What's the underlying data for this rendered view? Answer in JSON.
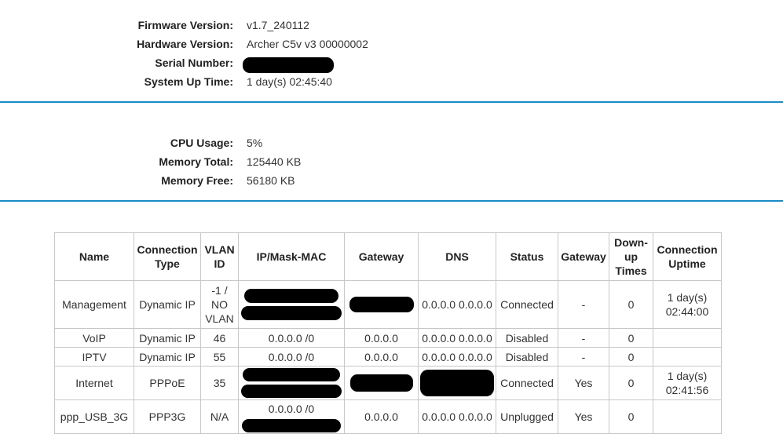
{
  "device_info": {
    "firmware": {
      "label": "Firmware Version:",
      "value": "v1.7_240112"
    },
    "hardware": {
      "label": "Hardware Version:",
      "value": "Archer C5v v3 00000002"
    },
    "serial": {
      "label": "Serial Number:",
      "value": ""
    },
    "uptime": {
      "label": "System Up Time:",
      "value": "1 day(s) 02:45:40"
    }
  },
  "resources": {
    "cpu": {
      "label": "CPU Usage:",
      "value": "5%"
    },
    "mem_total": {
      "label": "Memory Total:",
      "value": "125440 KB"
    },
    "mem_free": {
      "label": "Memory Free:",
      "value": "56180 KB"
    }
  },
  "wan_table": {
    "headers": {
      "name": "Name",
      "conn_type_1": "Connection",
      "conn_type_2": "Type",
      "vlan_1": "VLAN",
      "vlan_2": "ID",
      "ip_mask_mac": "IP/Mask-MAC",
      "gateway": "Gateway",
      "dns": "DNS",
      "status": "Status",
      "gateway2": "Gateway",
      "down_1": "Down-",
      "down_2": "up",
      "down_3": "Times",
      "uptime_1": "Connection",
      "uptime_2": "Uptime"
    },
    "rows": [
      {
        "name": "Management",
        "conn_type": "Dynamic IP",
        "vlan_1": "-1 /",
        "vlan_2": "NO",
        "vlan_3": "VLAN",
        "ip_mask_mac": "",
        "gateway": "",
        "dns": "0.0.0.0 0.0.0.0",
        "status": "Connected",
        "gateway2": "-",
        "down_times": "0",
        "uptime_1": "1 day(s)",
        "uptime_2": "02:44:00"
      },
      {
        "name": "VoIP",
        "conn_type": "Dynamic IP",
        "vlan": "46",
        "ip_mask_mac": "0.0.0.0 /0",
        "gateway": "0.0.0.0",
        "dns": "0.0.0.0 0.0.0.0",
        "status": "Disabled",
        "gateway2": "-",
        "down_times": "0",
        "uptime": ""
      },
      {
        "name": "IPTV",
        "conn_type": "Dynamic IP",
        "vlan": "55",
        "ip_mask_mac": "0.0.0.0 /0",
        "gateway": "0.0.0.0",
        "dns": "0.0.0.0 0.0.0.0",
        "status": "Disabled",
        "gateway2": "-",
        "down_times": "0",
        "uptime": ""
      },
      {
        "name": "Internet",
        "conn_type": "PPPoE",
        "vlan": "35",
        "ip_mask_mac": "",
        "gateway": "",
        "dns": "",
        "status": "Connected",
        "gateway2": "Yes",
        "down_times": "0",
        "uptime_1": "1 day(s)",
        "uptime_2": "02:41:56"
      },
      {
        "name": "ppp_USB_3G",
        "conn_type": "PPP3G",
        "vlan": "N/A",
        "ip_mask_mac": "0.0.0.0 /0",
        "gateway": "0.0.0.0",
        "dns": "0.0.0.0 0.0.0.0",
        "status": "Unplugged",
        "gateway2": "Yes",
        "down_times": "0",
        "uptime": ""
      }
    ]
  },
  "colors": {
    "divider": "#1a8cc8",
    "redaction": "#000000",
    "table_border": "#c8c8c8"
  }
}
